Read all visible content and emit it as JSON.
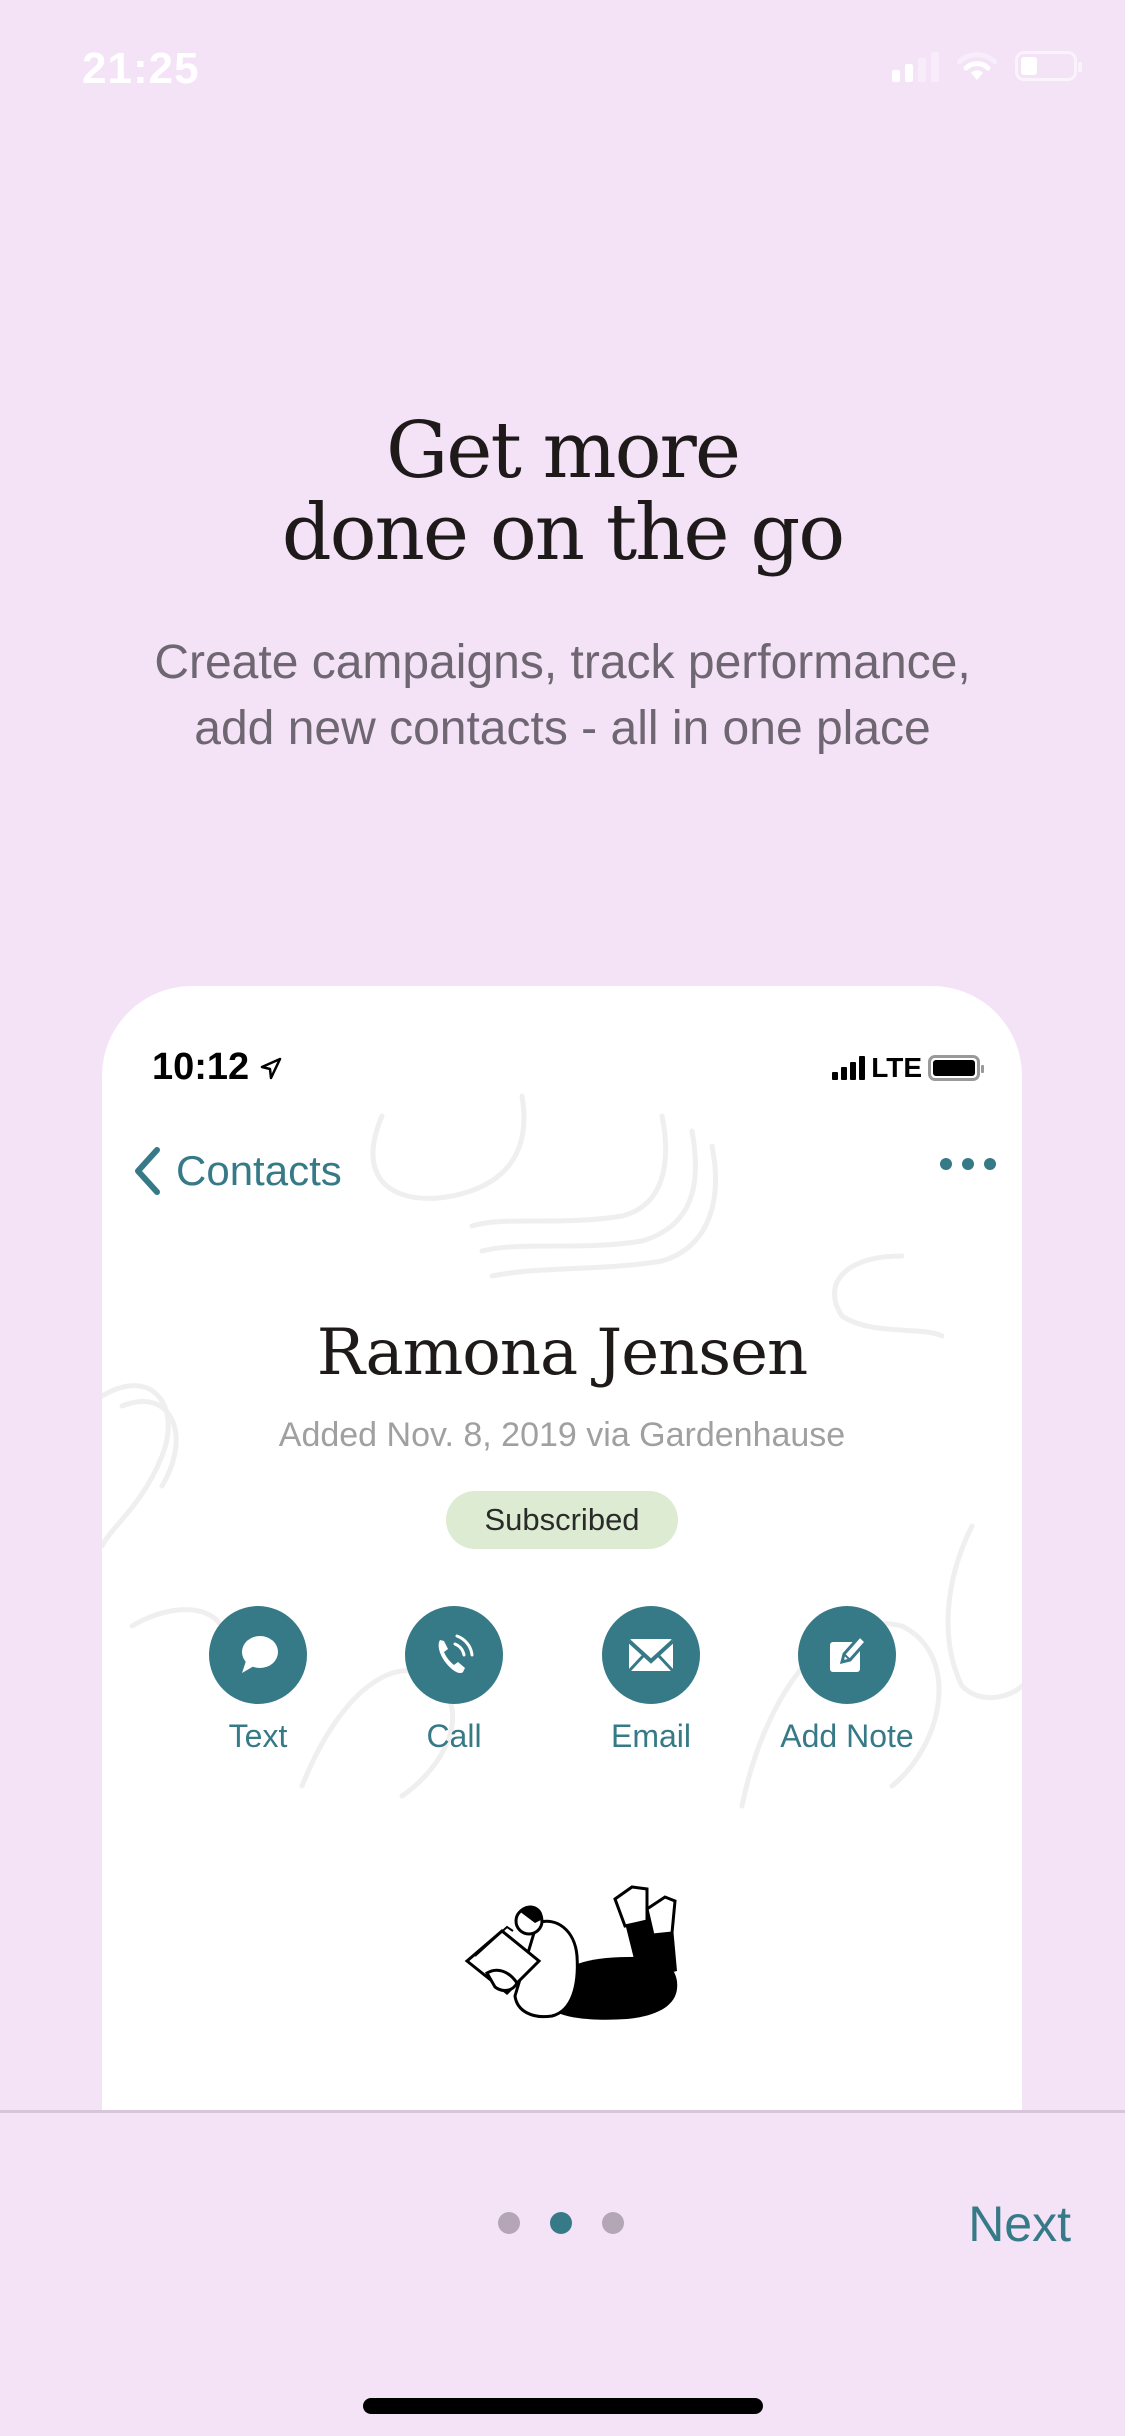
{
  "status_bar": {
    "time": "21:25",
    "icons": [
      "cellular-signal-icon",
      "wifi-icon",
      "battery-icon"
    ]
  },
  "onboarding": {
    "headline_line1": "Get more",
    "headline_line2": "done on the go",
    "subtitle_line1": "Create campaigns, track performance,",
    "subtitle_line2": "add new contacts - all in one place"
  },
  "preview": {
    "status_bar": {
      "time": "10:12",
      "network": "LTE",
      "icons": [
        "location-arrow-icon",
        "cellular-signal-icon",
        "battery-icon"
      ]
    },
    "nav": {
      "back_label": "Contacts",
      "more_icon": "more-horizontal-icon"
    },
    "contact": {
      "name": "Ramona Jensen",
      "meta": "Added Nov. 8, 2019 via Gardenhause",
      "status_badge": "Subscribed"
    },
    "actions": [
      {
        "label": "Text",
        "icon": "chat-bubble-icon"
      },
      {
        "label": "Call",
        "icon": "phone-call-icon"
      },
      {
        "label": "Email",
        "icon": "envelope-icon"
      },
      {
        "label": "Add Note",
        "icon": "edit-note-icon"
      }
    ],
    "illustration": "person-reading-illustration"
  },
  "footer": {
    "page_count": 3,
    "current_page": 2,
    "next_label": "Next"
  },
  "colors": {
    "background": "#f4e2f7",
    "accent": "#377a87",
    "badge_bg": "#dcebd2",
    "dot_inactive": "#b5a6b7"
  }
}
